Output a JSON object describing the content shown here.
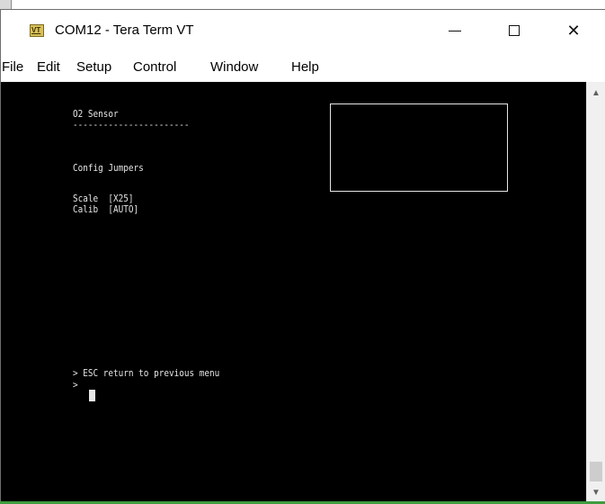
{
  "window": {
    "title": "COM12 - Tera Term VT",
    "icon_name": "tera-term-vt-icon",
    "icon_text": "VT",
    "controls": {
      "minimize": "minimize-icon",
      "maximize": "maximize-icon",
      "close": "close-icon",
      "close_glyph": "✕"
    }
  },
  "menu": {
    "items": [
      "File",
      "Edit",
      "Setup",
      "Control",
      "Window",
      "Help"
    ]
  },
  "terminal": {
    "lines": [
      "O2 Sensor",
      "-----------------------",
      "Config Jumpers",
      "Scale  [X25]",
      "Calib  [AUTO]",
      "> ESC return to previous menu",
      ">"
    ],
    "colors": {
      "background": "#000000",
      "foreground": "#e6e6e6"
    }
  },
  "scrollbar": {
    "up_icon": "scroll-up-arrow-icon",
    "down_icon": "scroll-down-arrow-icon",
    "up_glyph": "▲",
    "down_glyph": "▼"
  }
}
